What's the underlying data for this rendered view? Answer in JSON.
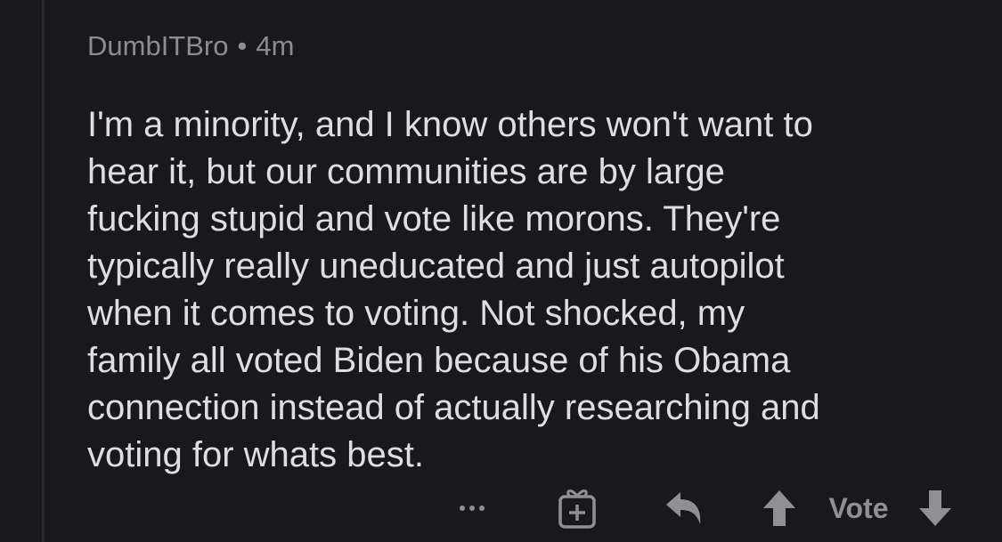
{
  "comment": {
    "author": "DumbITBro",
    "separator": "•",
    "age": "4m",
    "lines": [
      "I'm a minority, and I know others won't want to",
      "hear it, but our communities are by large",
      "fucking stupid and vote like morons. They're",
      "typically really uneducated and just autopilot",
      "when it comes to voting. Not shocked, my",
      "family all voted Biden because of his Obama",
      "connection instead of actually researching and",
      "voting for whats best."
    ]
  },
  "actions": {
    "more_icon": "more-dots-icon",
    "award_icon": "gift-icon",
    "reply_icon": "reply-arrow-icon",
    "upvote_icon": "arrow-up-icon",
    "vote_label": "Vote",
    "downvote_icon": "arrow-down-icon"
  },
  "colors": {
    "background": "#19191b",
    "text": "#dedee2",
    "meta": "#8c8c91",
    "icon": "#8f8f94",
    "thread_line": "#2b2b2e"
  }
}
